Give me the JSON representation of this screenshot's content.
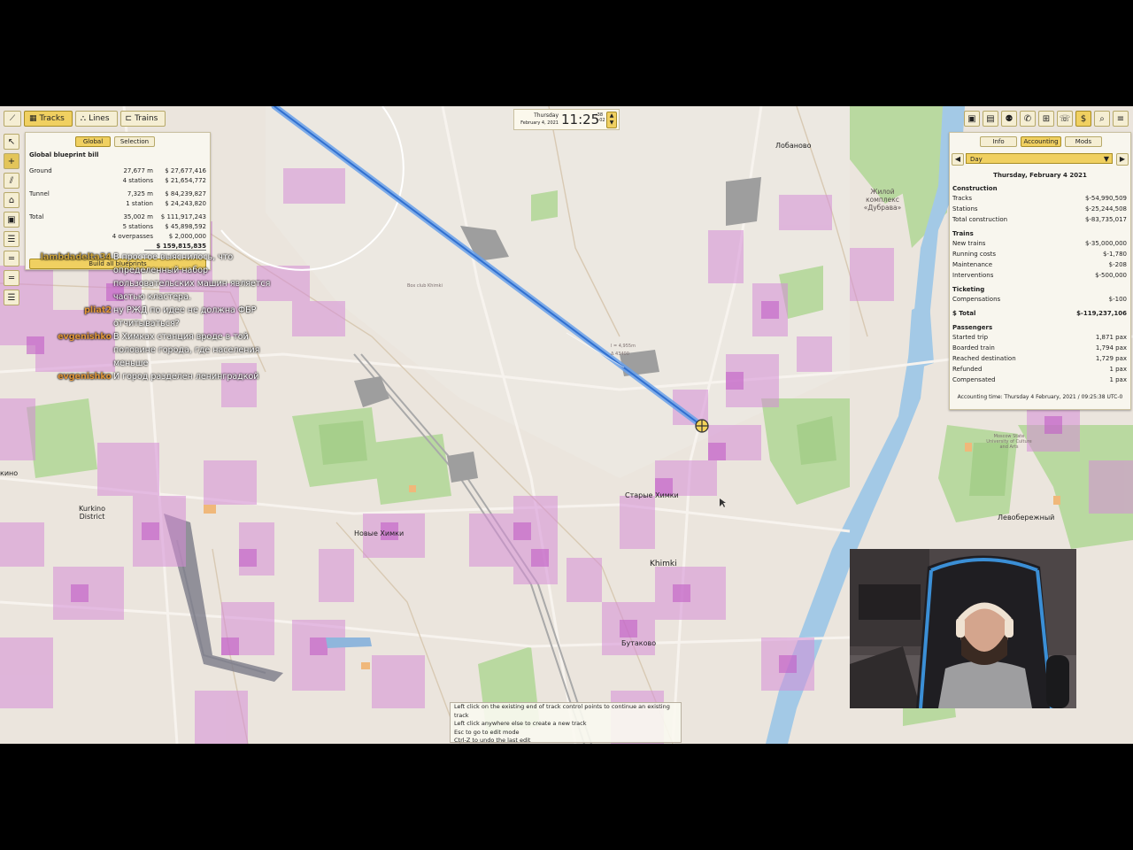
{
  "toolbar": {
    "tabs": [
      {
        "label": "Tracks",
        "icon": "tracks-icon"
      },
      {
        "label": "Lines",
        "icon": "lines-icon"
      },
      {
        "label": "Trains",
        "icon": "trains-icon"
      }
    ],
    "left_tools": [
      "pointer-icon",
      "add-icon",
      "edit-track-icon",
      "station-icon",
      "depot-icon",
      "track-type-1-icon",
      "track-type-2-icon",
      "track-type-3-icon",
      "track-type-4-icon"
    ],
    "right_tools": [
      "blueprint-icon",
      "city-icon",
      "people-icon",
      "phone-icon",
      "book-icon",
      "call-icon",
      "money-icon",
      "search-icon",
      "menu-icon"
    ]
  },
  "blueprint": {
    "tabs": [
      "Global",
      "Selection"
    ],
    "title": "Global blueprint bill",
    "rows": [
      {
        "label": "Ground",
        "qty": "27,677 m",
        "cost": "$ 27,677,416"
      },
      {
        "label": "",
        "qty": "4 stations",
        "cost": "$ 21,654,772"
      },
      {
        "label": "Tunnel",
        "qty": "7,325 m",
        "cost": "$ 84,239,827"
      },
      {
        "label": "",
        "qty": "1 station",
        "cost": "$ 24,243,820"
      },
      {
        "label": "Total",
        "qty": "35,002 m",
        "cost": "$ 111,917,243"
      },
      {
        "label": "",
        "qty": "5 stations",
        "cost": "$ 45,898,592"
      },
      {
        "label": "",
        "qty": "4 overpasses",
        "cost": "$ 2,000,000"
      },
      {
        "label": "",
        "qty": "",
        "cost": "$ 159,815,835"
      }
    ],
    "build_label": "Build all blueprints"
  },
  "clock": {
    "day": "Thursday",
    "date": "February 4, 2021",
    "time": "11:25",
    "seconds": ":38",
    "offset": "+02"
  },
  "accounting": {
    "tabs": [
      "Info",
      "Accounting",
      "Mods"
    ],
    "period": "Day",
    "date": "Thursday, February 4 2021",
    "construction_title": "Construction",
    "construction": [
      {
        "label": "Tracks",
        "value": "$-54,990,509"
      },
      {
        "label": "Stations",
        "value": "$-25,244,508"
      },
      {
        "label": "Total construction",
        "value": "$-83,735,017"
      }
    ],
    "trains_title": "Trains",
    "trains": [
      {
        "label": "New trains",
        "value": "$-35,000,000"
      },
      {
        "label": "Running costs",
        "value": "$-1,780"
      },
      {
        "label": "Maintenance",
        "value": "$-208"
      },
      {
        "label": "Interventions",
        "value": "$-500,000"
      }
    ],
    "ticketing_title": "Ticketing",
    "ticketing": [
      {
        "label": "Compensations",
        "value": "$-100"
      }
    ],
    "total_label": "$ Total",
    "total_value": "$-119,237,106",
    "passengers_title": "Passengers",
    "passengers": [
      {
        "label": "Started trip",
        "value": "1,871 pax"
      },
      {
        "label": "Boarded train",
        "value": "1,794 pax"
      },
      {
        "label": "Reached destination",
        "value": "1,729 pax"
      },
      {
        "label": "Refunded",
        "value": "1 pax"
      },
      {
        "label": "Compensated",
        "value": "1 pax"
      }
    ],
    "footer": "Accounting time: Thursday 4 February, 2021 / 09:25:38 UTC-0"
  },
  "chat": [
    {
      "user": "lambdadelta34",
      "message": "В простое выяснилось, что определенный набор пользовательских машин является частью кластера."
    },
    {
      "user": "pliat2",
      "message": "ну РЖД по идее не должна ФБР отчитываться?"
    },
    {
      "user": "evgenishko",
      "message": "В Химках станция вроде в той половине города, где населения меньше"
    },
    {
      "user": "evgenishko",
      "message": "И город разделен ленинградкой"
    }
  ],
  "map_labels": {
    "lobanovo": "Лобаново",
    "dubrava": "Жилой комплекс «Дубрава»",
    "kurkino": "Kurkino District",
    "novye_khimki": "Новые Химки",
    "starye_khimki": "Старые Химки",
    "khimki": "Khimki",
    "butakovo": "Бутаково",
    "levoberezhny": "Левобережный",
    "kino": "кино",
    "track_measure": "l = 4,955m",
    "track_measure2": "Δ 43400",
    "box_club": "Box club Khimki",
    "moscow_state": "Moscow State University of Culture and Arts"
  },
  "help": [
    "Left click on the existing end of track control points to continue an existing track",
    "Left click anywhere else to create a new track",
    "Esc to go to edit mode",
    "Ctrl-Z to undo the last edit"
  ]
}
